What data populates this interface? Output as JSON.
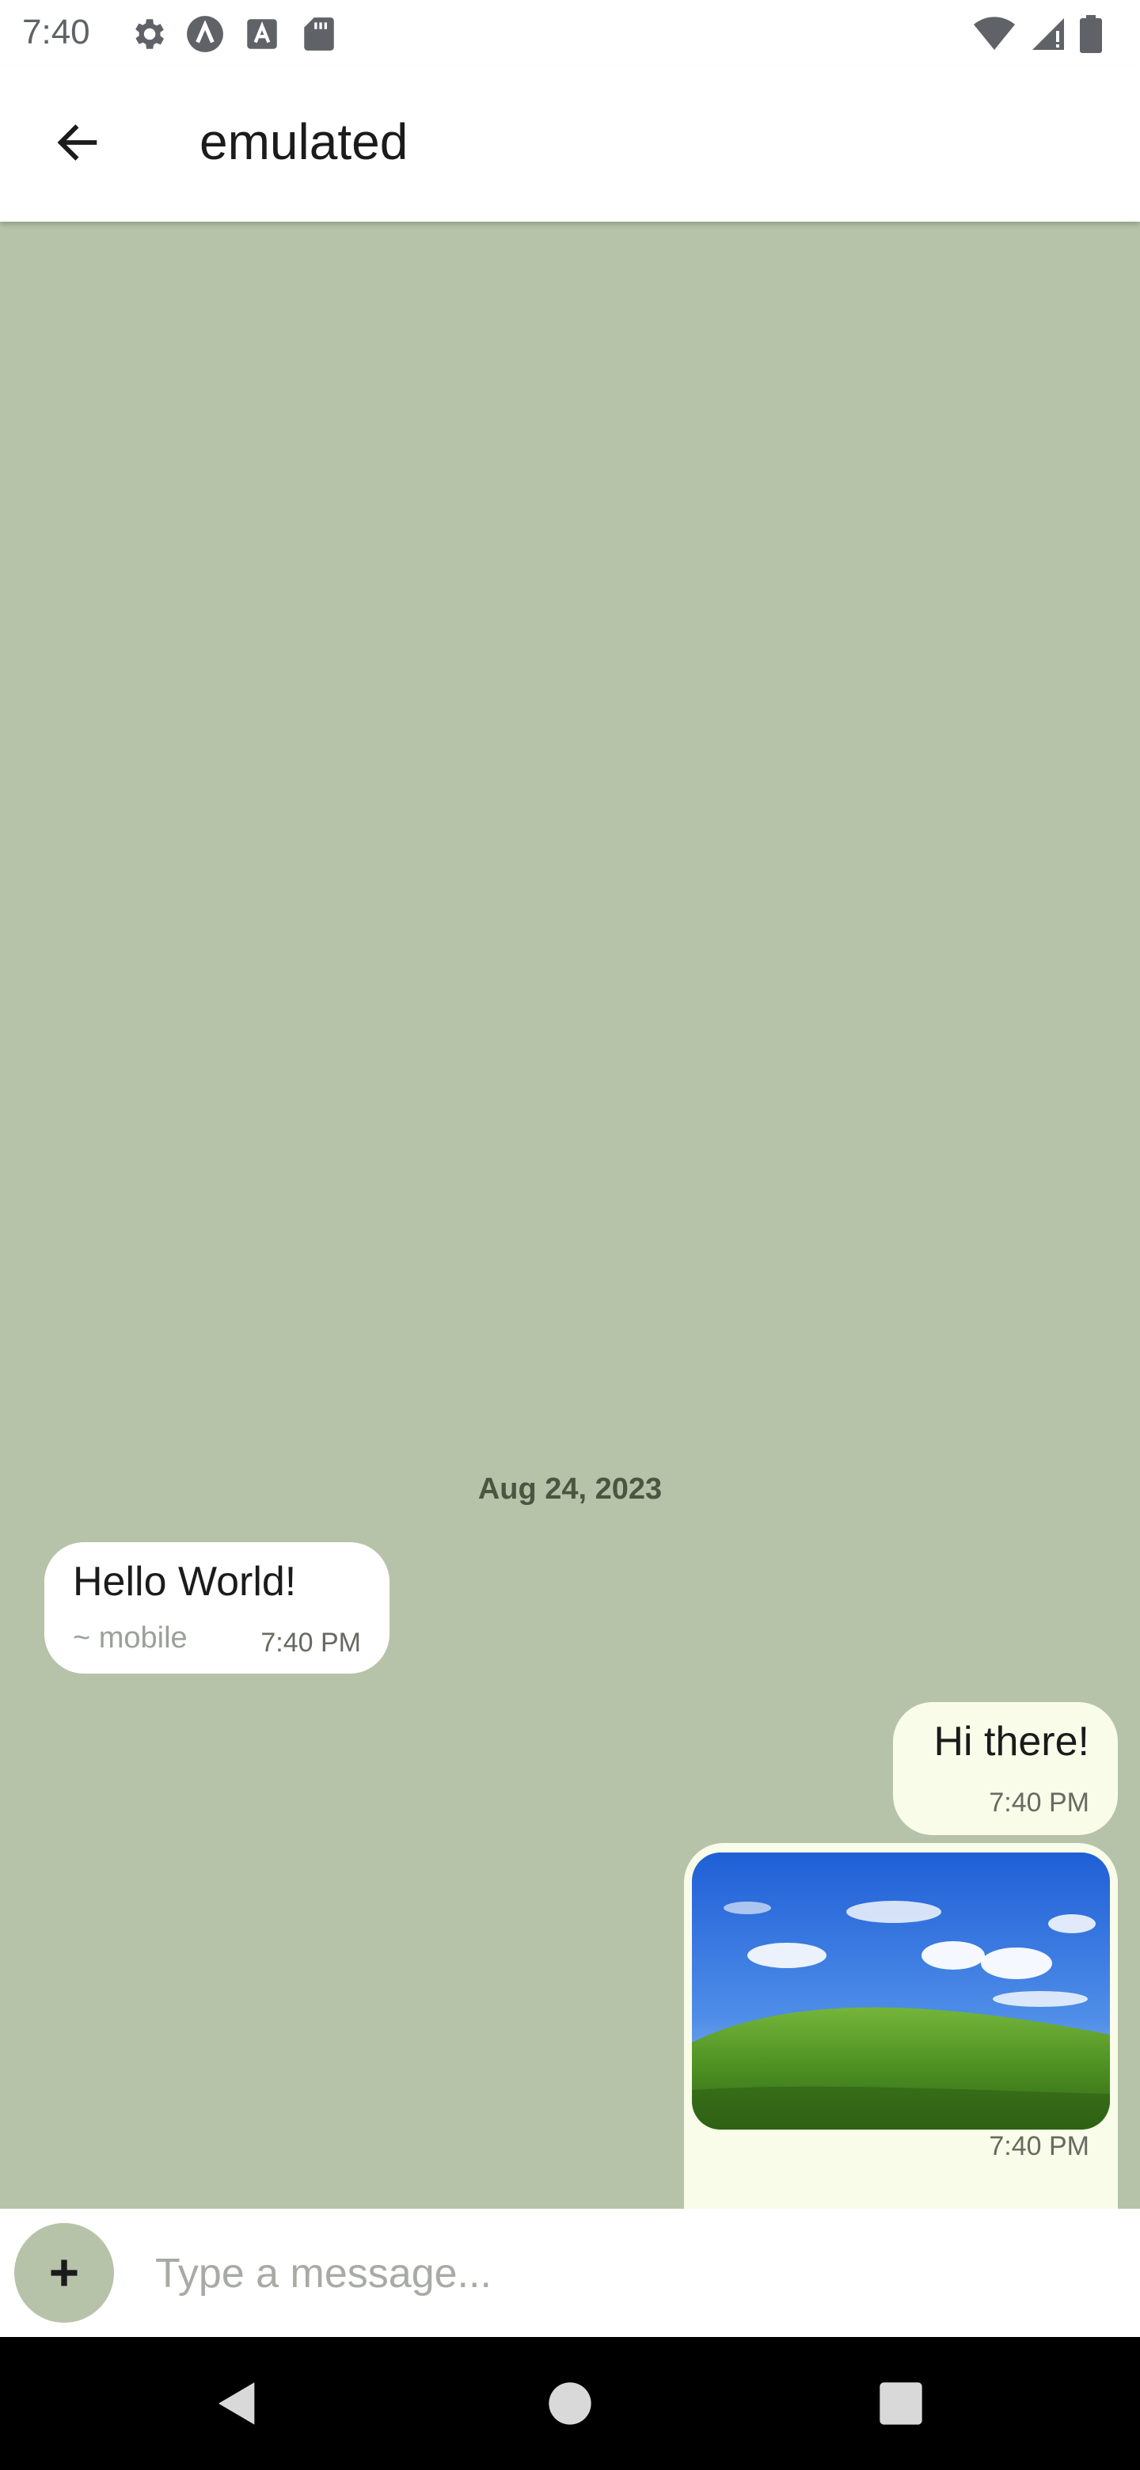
{
  "status_bar": {
    "time": "7:40",
    "icons_left": [
      "settings-icon",
      "app-a-circle-icon",
      "font-a-icon",
      "sd-card-icon"
    ],
    "icons_right": [
      "wifi-icon",
      "signal-icon",
      "battery-icon"
    ]
  },
  "app_bar": {
    "title": "emulated",
    "back_icon": "arrow-left-icon"
  },
  "chat": {
    "background_color": "#b7c3a9",
    "date_divider": "Aug 24, 2023",
    "messages": [
      {
        "direction": "incoming",
        "text": "Hello World!",
        "sender": "~ mobile",
        "time": "7:40 PM"
      },
      {
        "direction": "outgoing",
        "text": "Hi there!",
        "time": "7:40 PM"
      },
      {
        "direction": "outgoing",
        "image": "landscape-hill-photo",
        "time": "7:40 PM"
      }
    ]
  },
  "composer": {
    "placeholder": "Type a message...",
    "value": "",
    "attach_icon": "plus-icon"
  },
  "nav_bar": {
    "icons": [
      "nav-back-icon",
      "nav-home-icon",
      "nav-recents-icon"
    ]
  },
  "colors": {
    "incoming_bubble": "#ffffff",
    "outgoing_bubble": "#f9fce9",
    "accent": "#b7c3a9"
  }
}
